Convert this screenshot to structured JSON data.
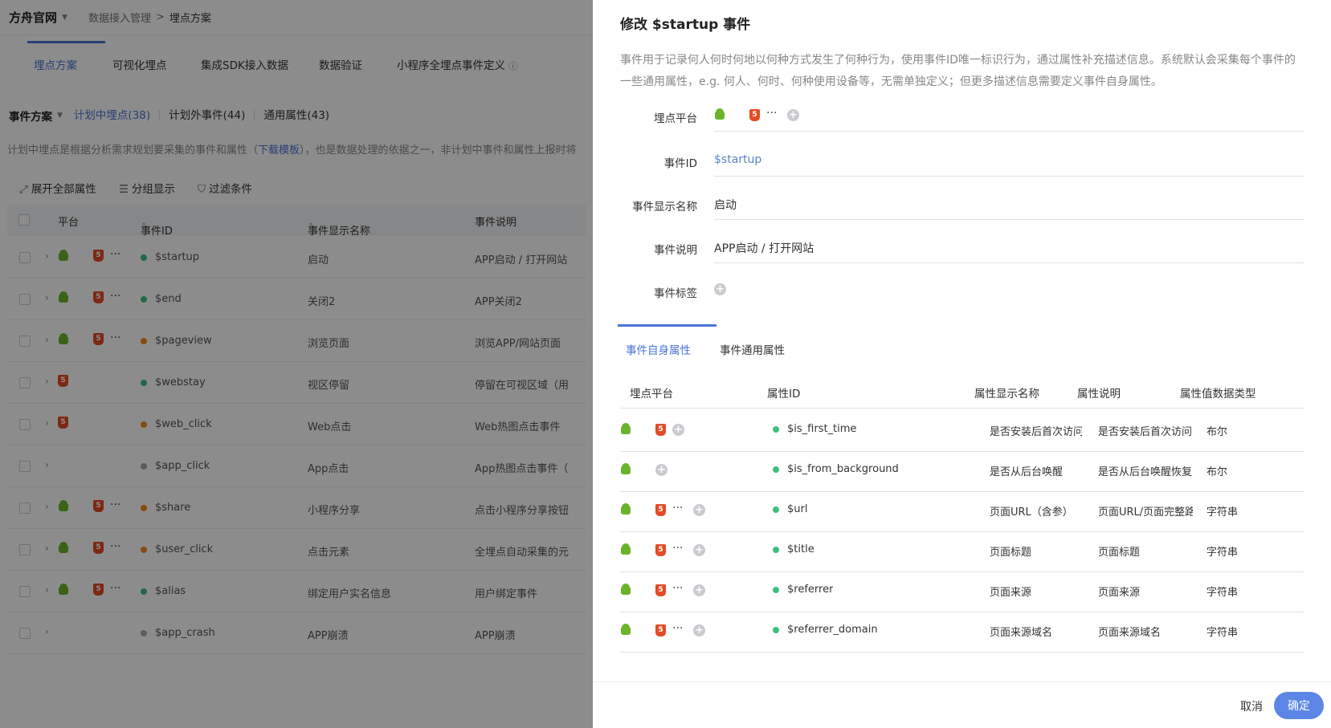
{
  "header": {
    "brand": "方舟官网",
    "breadcrumb": [
      "数据接入管理",
      "埋点方案"
    ]
  },
  "main_tabs": [
    "埋点方案",
    "可视化埋点",
    "集成SDK接入数据",
    "数据验证",
    "小程序全埋点事件定义"
  ],
  "sub": {
    "title": "事件方案",
    "segments": [
      "计划中埋点(38)",
      "计划外事件(44)",
      "通用属性(43)"
    ]
  },
  "description": {
    "text_before": "计划中埋点是根据分析需求规划要采集的事件和属性（",
    "link": "下载模板",
    "text_after": "），也是数据处理的依据之一，非计划中事件和属性上报时将"
  },
  "toolbar": {
    "expand": "展开全部属性",
    "group": "分组显示",
    "filter": "过滤条件"
  },
  "table": {
    "headers": [
      "平台",
      "事件ID",
      "事件显示名称",
      "事件说明"
    ],
    "rows": [
      {
        "platforms": [
          "android",
          "apple",
          "html5",
          "more"
        ],
        "status": "#3fbf7f",
        "id": "$startup",
        "name": "启动",
        "desc": "APP启动 / 打开网站"
      },
      {
        "platforms": [
          "android",
          "apple",
          "html5",
          "more"
        ],
        "status": "#3fbf7f",
        "id": "$end",
        "name": "关闭2",
        "desc": "APP关闭2"
      },
      {
        "platforms": [
          "android",
          "apple",
          "html5",
          "more"
        ],
        "status": "#f28a1c",
        "id": "$pageview",
        "name": "浏览页面",
        "desc": "浏览APP/网站页面"
      },
      {
        "platforms": [
          "html5"
        ],
        "status": "#3fbf7f",
        "id": "$webstay",
        "name": "视区停留",
        "desc": "停留在可视区域（用"
      },
      {
        "platforms": [
          "html5"
        ],
        "status": "#f28a1c",
        "id": "$web_click",
        "name": "Web点击",
        "desc": "Web热图点击事件"
      },
      {
        "platforms": [],
        "status": "#aaaaaa",
        "id": "$app_click",
        "name": "App点击",
        "desc": "App热图点击事件（"
      },
      {
        "platforms": [
          "android",
          "apple",
          "html5",
          "more"
        ],
        "status": "#f28a1c",
        "id": "$share",
        "name": "小程序分享",
        "desc": "点击小程序分享按钮"
      },
      {
        "platforms": [
          "android",
          "apple",
          "html5",
          "more"
        ],
        "status": "#f28a1c",
        "id": "$user_click",
        "name": "点击元素",
        "desc": "全埋点自动采集的元"
      },
      {
        "platforms": [
          "android",
          "apple",
          "html5",
          "more"
        ],
        "status": "#3fbf7f",
        "id": "$alias",
        "name": "绑定用户实名信息",
        "desc": "用户绑定事件"
      },
      {
        "platforms": [],
        "status": "#aaaaaa",
        "id": "$app_crash",
        "name": "APP崩溃",
        "desc": "APP崩溃"
      }
    ]
  },
  "drawer": {
    "title": "修改 $startup 事件",
    "description": "事件用于记录何人何时何地以何种方式发生了何种行为，使用事件ID唯一标识行为，通过属性补充描述信息。系统默认会采集每个事件的一些通用属性，e.g. 何人、何时、何种使用设备等，无需单独定义；但更多描述信息需要定义事件自身属性。",
    "fields": {
      "platform_label": "埋点平台",
      "id_label": "事件ID",
      "id_value": "$startup",
      "name_label": "事件显示名称",
      "name_value": "启动",
      "desc_label": "事件说明",
      "desc_value": "APP启动 / 打开网站",
      "tag_label": "事件标签"
    },
    "tabs": [
      "事件自身属性",
      "事件通用属性"
    ],
    "prop_headers": [
      "埋点平台",
      "属性ID",
      "属性显示名称",
      "属性说明",
      "属性值数据类型"
    ],
    "props": [
      {
        "platforms": [
          "android",
          "apple",
          "html5",
          "plus"
        ],
        "id": "$is_first_time",
        "name": "是否安装后首次访问",
        "desc": "是否安装后首次访问",
        "type": "布尔"
      },
      {
        "platforms": [
          "android",
          "apple",
          "plus"
        ],
        "id": "$is_from_background",
        "name": "是否从后台唤醒",
        "desc": "是否从后台唤醒恢复",
        "type": "布尔"
      },
      {
        "platforms": [
          "android",
          "apple",
          "html5",
          "more",
          "plus"
        ],
        "id": "$url",
        "name": "页面URL（含参）",
        "desc": "页面URL/页面完整路径",
        "type": "字符串"
      },
      {
        "platforms": [
          "android",
          "apple",
          "html5",
          "more",
          "plus"
        ],
        "id": "$title",
        "name": "页面标题",
        "desc": "页面标题",
        "type": "字符串"
      },
      {
        "platforms": [
          "android",
          "apple",
          "html5",
          "more",
          "plus"
        ],
        "id": "$referrer",
        "name": "页面来源",
        "desc": "页面来源",
        "type": "字符串"
      },
      {
        "platforms": [
          "android",
          "apple",
          "html5",
          "more",
          "plus"
        ],
        "id": "$referrer_domain",
        "name": "页面来源域名",
        "desc": "页面来源域名",
        "type": "字符串"
      }
    ],
    "cancel": "取消",
    "confirm": "确定"
  }
}
